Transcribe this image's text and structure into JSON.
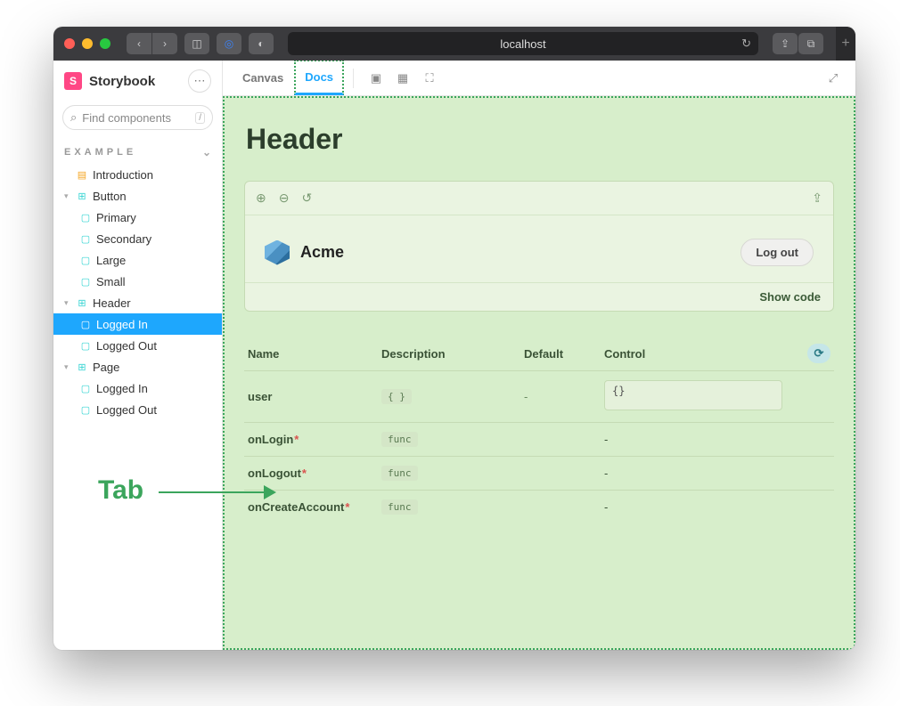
{
  "browser": {
    "address": "localhost"
  },
  "brand": "Storybook",
  "search": {
    "placeholder": "Find components",
    "shortcut": "/"
  },
  "section_label": "EXAMPLE",
  "tree": {
    "introduction": "Introduction",
    "button": {
      "label": "Button",
      "primary": "Primary",
      "secondary": "Secondary",
      "large": "Large",
      "small": "Small"
    },
    "header": {
      "label": "Header",
      "logged_in": "Logged In",
      "logged_out": "Logged Out"
    },
    "page": {
      "label": "Page",
      "logged_in": "Logged In",
      "logged_out": "Logged Out"
    }
  },
  "tabs": {
    "canvas": "Canvas",
    "docs": "Docs"
  },
  "doc": {
    "title": "Header",
    "component": {
      "name": "Acme",
      "logout": "Log out"
    },
    "showcode": "Show code"
  },
  "args": {
    "cols": {
      "name": "Name",
      "desc": "Description",
      "def": "Default",
      "ctrl": "Control"
    },
    "rows": [
      {
        "name": "user",
        "required": false,
        "desc": "{ }",
        "def": "-",
        "ctrl": "{}"
      },
      {
        "name": "onLogin",
        "required": true,
        "desc": "func",
        "def": "",
        "ctrl": "-"
      },
      {
        "name": "onLogout",
        "required": true,
        "desc": "func",
        "def": "",
        "ctrl": "-"
      },
      {
        "name": "onCreateAccount",
        "required": true,
        "desc": "func",
        "def": "",
        "ctrl": "-"
      }
    ]
  },
  "annotation": "Tab"
}
